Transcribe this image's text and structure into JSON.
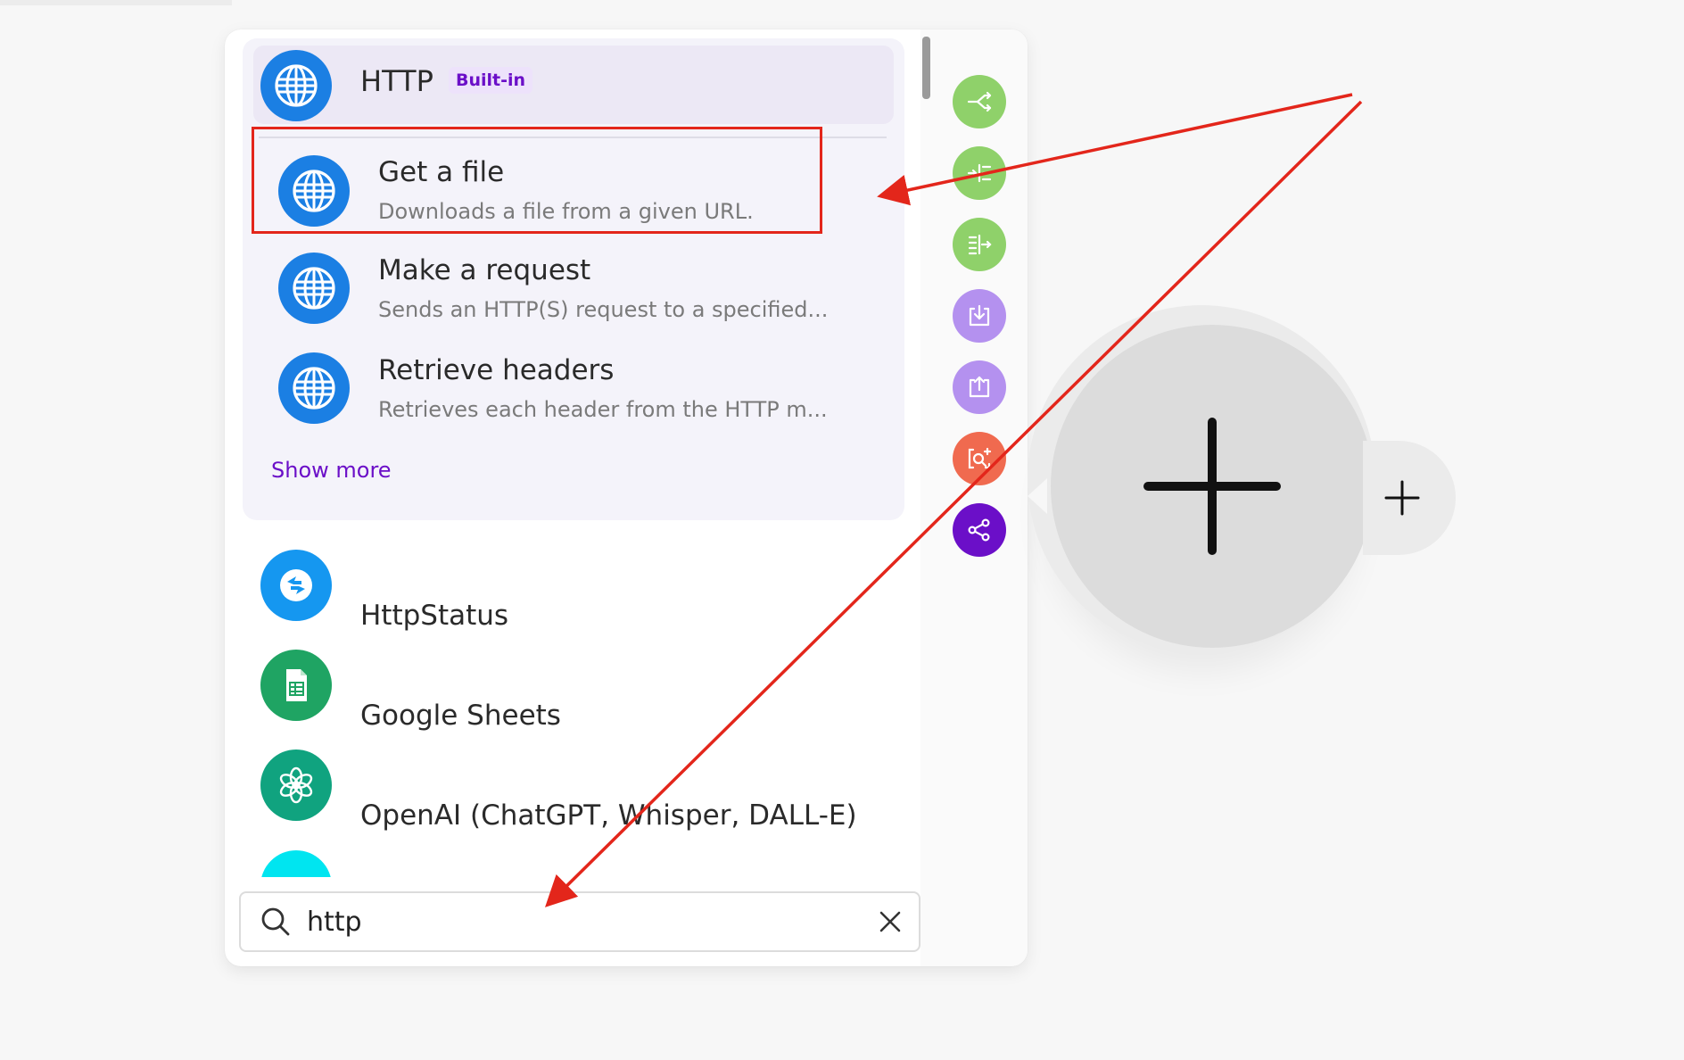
{
  "http_group": {
    "name": "HTTP",
    "badge": "Built-in",
    "modules": [
      {
        "title": "Get a file",
        "description": "Downloads a file from a given URL."
      },
      {
        "title": "Make a request",
        "description": "Sends an HTTP(S) request to a specified..."
      },
      {
        "title": "Retrieve headers",
        "description": "Retrieves each header from the HTTP m..."
      }
    ],
    "show_more": "Show more"
  },
  "apps": [
    {
      "name": "HttpStatus",
      "icon": "httpstatus-icon",
      "color": "#1597f0"
    },
    {
      "name": "Google Sheets",
      "icon": "google-sheets-icon",
      "color": "#1fa463"
    },
    {
      "name": "OpenAI (ChatGPT, Whisper, DALL-E)",
      "icon": "openai-icon",
      "color": "#10a37f"
    }
  ],
  "search": {
    "value": "http"
  },
  "toolbar": [
    {
      "icon": "router-icon",
      "color": "#8fd16a"
    },
    {
      "icon": "iterator-icon",
      "color": "#8fd16a"
    },
    {
      "icon": "aggregator-icon",
      "color": "#8fd16a"
    },
    {
      "icon": "import-icon",
      "color": "#b491ef"
    },
    {
      "icon": "export-icon",
      "color": "#b491ef"
    },
    {
      "icon": "search-add-icon",
      "color": "#f06a4f"
    },
    {
      "icon": "share-icon",
      "color": "#6b0fc8"
    }
  ],
  "colors": {
    "accent": "#6b0fc8",
    "annotation": "#e3261b",
    "http_blue": "#1b7fe3"
  }
}
